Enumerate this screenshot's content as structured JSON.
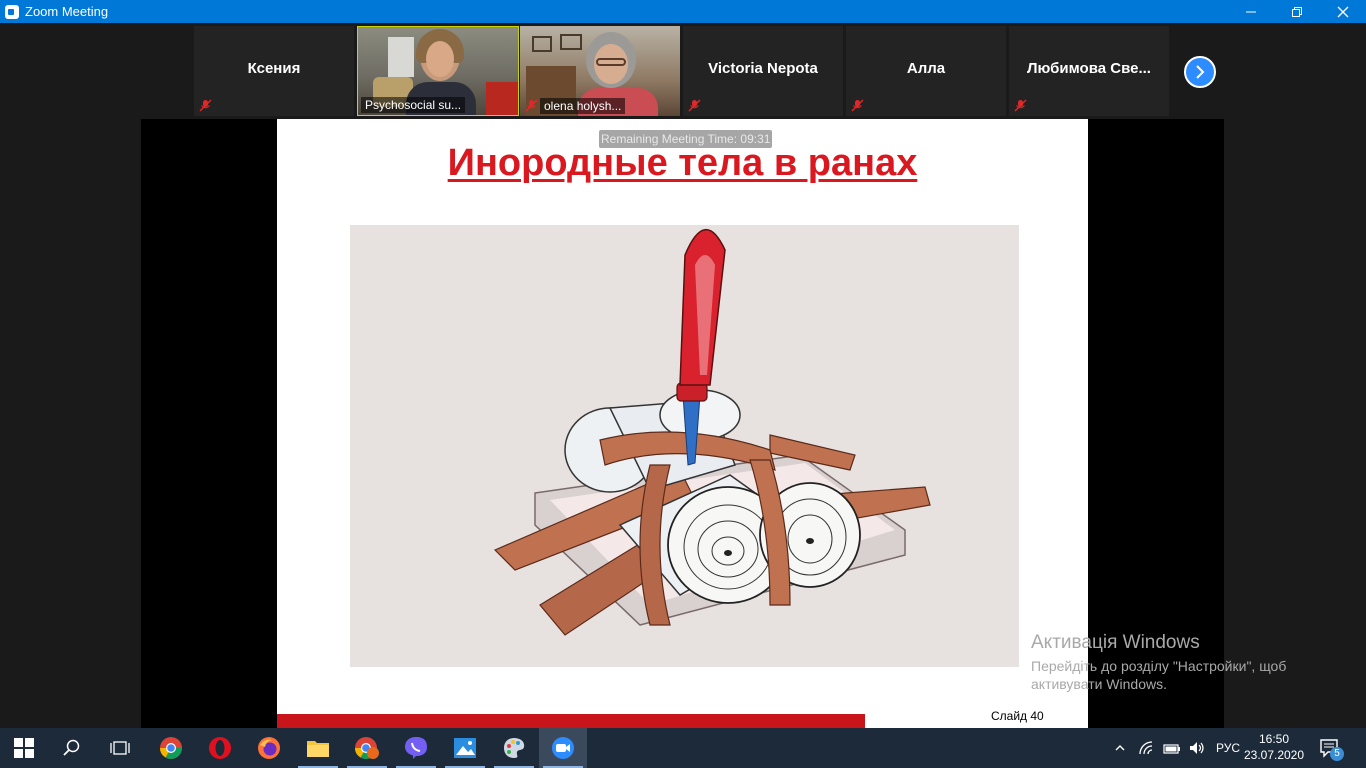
{
  "window": {
    "title": "Zoom Meeting",
    "controls": [
      "minimize",
      "restore",
      "close"
    ]
  },
  "participants": [
    {
      "name": "Ксения",
      "video": false,
      "muted": true
    },
    {
      "name": "Psychosocial su...",
      "video": true,
      "muted": false
    },
    {
      "name": "olena holysh...",
      "video": true,
      "muted": true
    },
    {
      "name": "Victoria Nepota",
      "video": false,
      "muted": true
    },
    {
      "name": "Алла",
      "video": false,
      "muted": true
    },
    {
      "name": "Любимова  Све...",
      "video": false,
      "muted": true
    }
  ],
  "meeting": {
    "remaining_time": "Remaining Meeting Time: 09:31"
  },
  "slide": {
    "title": "Инородные тела в ранах",
    "number_label": "Слайд 40",
    "accent_color": "#d9191f"
  },
  "activation_notice": {
    "title": "Активація Windows",
    "line1": "Перейдіть до розділу \"Настройки\", щоб",
    "line2": "активувати Windows."
  },
  "taskbar": {
    "apps": [
      "start",
      "search",
      "task-view",
      "chrome",
      "opera",
      "firefox",
      "file-explorer",
      "chrome-profile",
      "viber",
      "photos",
      "paint",
      "zoom"
    ],
    "language": "РУС",
    "time": "16:50",
    "date": "23.07.2020",
    "notifications_count": "5"
  }
}
